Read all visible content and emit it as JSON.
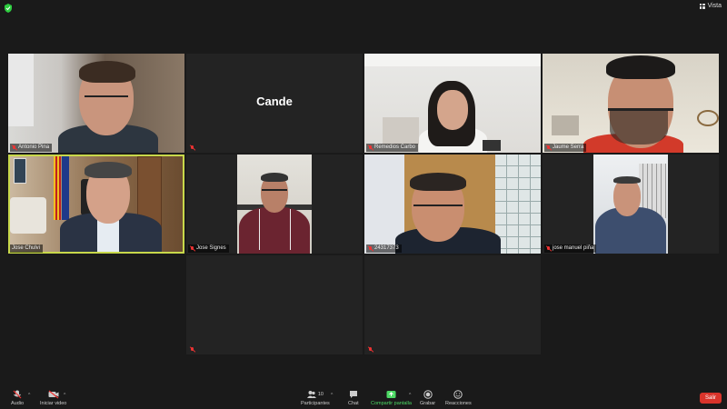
{
  "topbar": {
    "view_label": "Vista"
  },
  "participants": [
    {
      "name": "Antonio Pina"
    },
    {
      "name": "Cande",
      "display": "Cande"
    },
    {
      "name": "Remedios Carbo"
    },
    {
      "name": "Jaume Serra"
    },
    {
      "name": "Jose Chulvi"
    },
    {
      "name": "Jose Signes"
    },
    {
      "name": "24317373"
    },
    {
      "name": "jose manuel piña"
    },
    {
      "name": ""
    },
    {
      "name": ""
    }
  ],
  "toolbar": {
    "audio": "Audio",
    "video": "Iniciar video",
    "participants": "Participantes",
    "participants_count": "10",
    "chat": "Chat",
    "share": "Compartir pantalla",
    "record": "Grabar",
    "reactions": "Reacciones",
    "leave": "Salir"
  },
  "colors": {
    "active_speaker": "#c8d84a",
    "share": "#4cd964",
    "leave": "#d9342b",
    "muted": "#e33333"
  }
}
